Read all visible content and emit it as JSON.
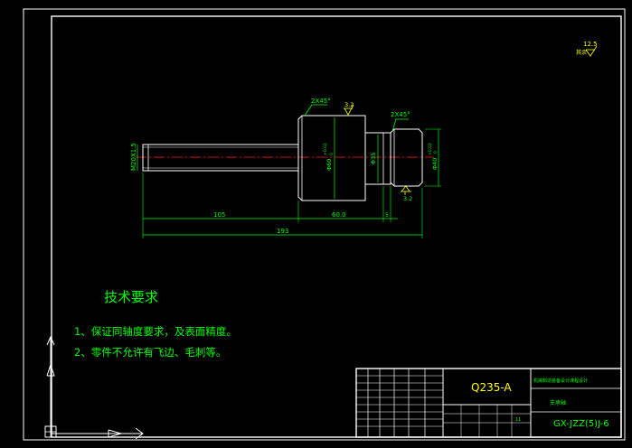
{
  "colors": {
    "background": "#000000",
    "frame": "#ffffff",
    "outline": "#ffffff",
    "dimension": "#00ff00",
    "centerline": "#ff2020",
    "annotation": "#ffff00",
    "text": "#00ff00"
  },
  "roughness": {
    "corner_value": "12.5",
    "corner_label": "其余",
    "top_value": "3.2",
    "right_value": "3.2"
  },
  "dimensions": {
    "chamfer_left": "2X45°",
    "chamfer_right": "2X45°",
    "thread": "M20X1.5",
    "dia_large": "Φ60",
    "dia_large_tol_top": "+0.02",
    "dia_large_tol_bottom": "0",
    "dia_mid": "Φ35",
    "dia_right": "Φ40",
    "dia_right_tol_top": "+0.02",
    "dia_right_tol_bottom": "0",
    "len_shaft": "105",
    "len_body": "60.0",
    "len_step": "5",
    "len_total": "193"
  },
  "notes": {
    "heading": "技术要求",
    "line1": "1、保证同轴度要求，及表面精度。",
    "line2": "2、零件不允许有飞边、毛刺等。"
  },
  "title_block": {
    "material": "Q235-A",
    "company": "机械制造装备设计课程设计",
    "part_name": "支承轴",
    "drawing_no": "GX-JZZ(5)J-6",
    "sheet_info": "11"
  }
}
